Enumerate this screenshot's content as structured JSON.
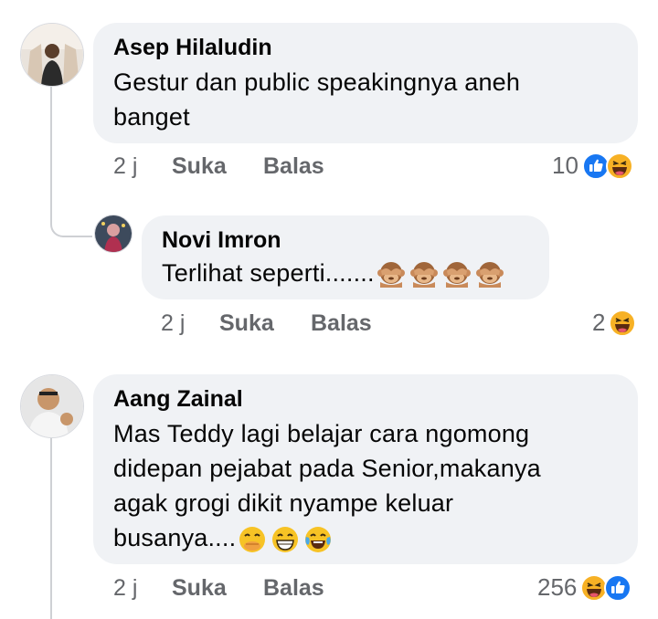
{
  "comments": [
    {
      "author": "Asep Hilaludin",
      "text_lines": [
        "Gestur dan public speakingnya aneh",
        "banget"
      ],
      "time": "2 j",
      "like_label": "Suka",
      "reply_label": "Balas",
      "reaction_count": "10",
      "reactions": [
        "like-reaction-icon",
        "haha-reaction-icon"
      ]
    },
    {
      "author": "Novi Imron",
      "text": "Terlihat seperti.......",
      "text_emojis": [
        "see-no-evil-monkey",
        "see-no-evil-monkey",
        "see-no-evil-monkey",
        "see-no-evil-monkey"
      ],
      "time": "2 j",
      "like_label": "Suka",
      "reply_label": "Balas",
      "reaction_count": "2",
      "reactions": [
        "haha-reaction-icon"
      ]
    },
    {
      "author": "Aang Zainal",
      "text_lines": [
        "Mas Teddy lagi belajar cara ngomong",
        "didepan pejabat pada Senior,makanya",
        "agak grogi dikit nyampe keluar"
      ],
      "last_line": "busanya....",
      "text_emojis": [
        "laughing-covering-mouth",
        "grinning-face",
        "tears-of-joy"
      ],
      "time": "2 j",
      "like_label": "Suka",
      "reply_label": "Balas",
      "reaction_count": "256",
      "reactions": [
        "haha-reaction-icon",
        "like-reaction-icon"
      ]
    }
  ],
  "colors": {
    "bubble": "#f0f2f5",
    "meta_text": "#65676b",
    "like_blue": "#1877f2",
    "haha_yellow": "#f7b125",
    "thread_line": "#ced0d4"
  }
}
